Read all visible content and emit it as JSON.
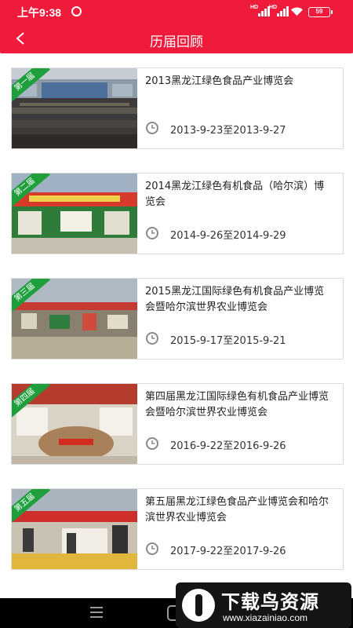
{
  "status": {
    "time": "上午9:38",
    "network1": "HD",
    "network2": "HD",
    "battery": "59"
  },
  "header": {
    "title": "历届回顾"
  },
  "cards": [
    {
      "badge": "第一届",
      "title": "2013黑龙江绿色食品产业博览会",
      "date": "2013-9-23至2013-9-27"
    },
    {
      "badge": "第二届",
      "title": "2014黑龙江绿色有机食品（哈尔滨）博览会",
      "date": "2014-9-26至2014-9-29"
    },
    {
      "badge": "第三届",
      "title": "2015黑龙江国际绿色有机食品产业博览会暨哈尔滨世界农业博览会",
      "date": "2015-9-17至2015-9-21"
    },
    {
      "badge": "第四届",
      "title": "第四届黑龙江国际绿色有机食品产业博览会暨哈尔滨世界农业博览会",
      "date": "2016-9-22至2016-9-26"
    },
    {
      "badge": "第五届",
      "title": "第五届黑龙江绿色食品产业博览会和哈尔滨世界农业博览会",
      "date": "2017-9-22至2017-9-26"
    }
  ],
  "watermark": {
    "title": "下载鸟资源",
    "url": "www.xiazainiao.com"
  },
  "colors": {
    "brand": "#f01a3b",
    "ribbon": "#1e9f3c"
  },
  "icons": {
    "back": "chevron-left-icon",
    "clock": "clock-icon",
    "menu": "menu-icon",
    "home": "home-icon"
  }
}
